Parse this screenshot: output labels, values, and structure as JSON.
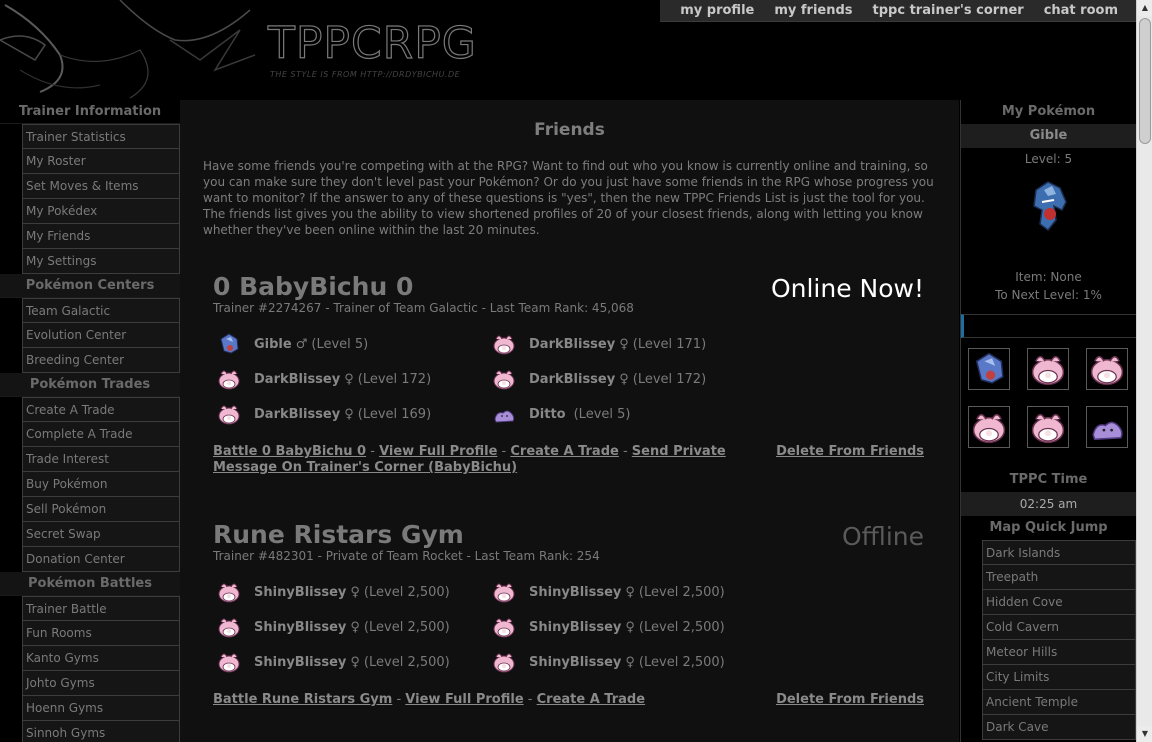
{
  "header": {
    "logo_title": "TPPCRPG",
    "logo_subtitle": "THE STYLE IS FROM HTTP://DRDYBICHU.DE"
  },
  "topnav": [
    "my profile",
    "my friends",
    "tppc trainer's corner",
    "chat room"
  ],
  "left_sidebar": [
    {
      "heading": "Trainer Information",
      "items": [
        "Trainer Statistics",
        "My Roster",
        "Set Moves & Items",
        "My Pokédex",
        "My Friends",
        "My Settings"
      ]
    },
    {
      "heading": "Pokémon Centers",
      "items": [
        "Team Galactic",
        "Evolution Center",
        "Breeding Center"
      ]
    },
    {
      "heading": "Pokémon Trades",
      "items": [
        "Create A Trade",
        "Complete A Trade",
        "Trade Interest",
        "Buy Pokémon",
        "Sell Pokémon",
        "Secret Swap",
        "Donation Center"
      ]
    },
    {
      "heading": "Pokémon Battles",
      "items": [
        "Trainer Battle",
        "Fun Rooms",
        "Kanto Gyms",
        "Johto Gyms",
        "Hoenn Gyms",
        "Sinnoh Gyms"
      ]
    }
  ],
  "main": {
    "title": "Friends",
    "intro": "Have some friends you're competing with at the RPG? Want to find out who you know is currently online and training, so you can make sure they don't level past your Pokémon? Or do you just have some friends in the RPG whose progress you want to monitor? If the answer to any of these questions is \"yes\", then the new TPPC Friends List is just the tool for you. The friends list gives you the ability to view shortened profiles of 20 of your closest friends, along with letting you know whether they've been online within the last 20 minutes.",
    "friends": [
      {
        "name": "0 BabyBichu 0",
        "status": "Online Now!",
        "subline": "Trainer #2274267 - Trainer of Team Galactic - Last Team Rank: 45,068",
        "pokemon": [
          {
            "name": "Gible",
            "gender": "♂",
            "level": "(Level 5)",
            "icon": "gible"
          },
          {
            "name": "DarkBlissey",
            "gender": "♀",
            "level": "(Level 171)",
            "icon": "blissey"
          },
          {
            "name": "DarkBlissey",
            "gender": "♀",
            "level": "(Level 172)",
            "icon": "blissey"
          },
          {
            "name": "DarkBlissey",
            "gender": "♀",
            "level": "(Level 172)",
            "icon": "blissey"
          },
          {
            "name": "DarkBlissey",
            "gender": "♀",
            "level": "(Level 169)",
            "icon": "blissey"
          },
          {
            "name": "Ditto",
            "gender": "",
            "level": "(Level 5)",
            "icon": "ditto"
          }
        ],
        "links": [
          "Battle 0 BabyBichu 0",
          "View Full Profile",
          "Create A Trade",
          "Send Private Message On Trainer's Corner (BabyBichu)"
        ],
        "delete": "Delete From Friends"
      },
      {
        "name": "Rune Ristars Gym",
        "status": "Offline",
        "subline": "Trainer #482301 - Private of Team Rocket - Last Team Rank: 254",
        "pokemon": [
          {
            "name": "ShinyBlissey",
            "gender": "♀",
            "level": "(Level 2,500)",
            "icon": "blissey"
          },
          {
            "name": "ShinyBlissey",
            "gender": "♀",
            "level": "(Level 2,500)",
            "icon": "blissey"
          },
          {
            "name": "ShinyBlissey",
            "gender": "♀",
            "level": "(Level 2,500)",
            "icon": "blissey"
          },
          {
            "name": "ShinyBlissey",
            "gender": "♀",
            "level": "(Level 2,500)",
            "icon": "blissey"
          },
          {
            "name": "ShinyBlissey",
            "gender": "♀",
            "level": "(Level 2,500)",
            "icon": "blissey"
          },
          {
            "name": "ShinyBlissey",
            "gender": "♀",
            "level": "(Level 2,500)",
            "icon": "blissey"
          }
        ],
        "links": [
          "Battle Rune Ristars Gym",
          "View Full Profile",
          "Create A Trade"
        ],
        "delete": "Delete From Friends"
      }
    ]
  },
  "right_sidebar": {
    "heading": "My Pokémon",
    "pokemon_name": "Gible",
    "level": "Level: 5",
    "item": "Item: None",
    "next_level": "To Next Level: 1%",
    "team_icons": [
      "gible",
      "blissey",
      "blissey",
      "blissey",
      "blissey",
      "ditto"
    ],
    "time_heading": "TPPC Time",
    "time": "02:25 am",
    "map_heading": "Map Quick Jump",
    "map_items": [
      "Dark Islands",
      "Treepath",
      "Hidden Cove",
      "Cold Cavern",
      "Meteor Hills",
      "City Limits",
      "Ancient Temple",
      "Dark Cave"
    ]
  },
  "colors": {
    "online": "#ffffff",
    "offline": "#5a5a5a",
    "text": "#7a7a7a",
    "background": "#000000"
  }
}
